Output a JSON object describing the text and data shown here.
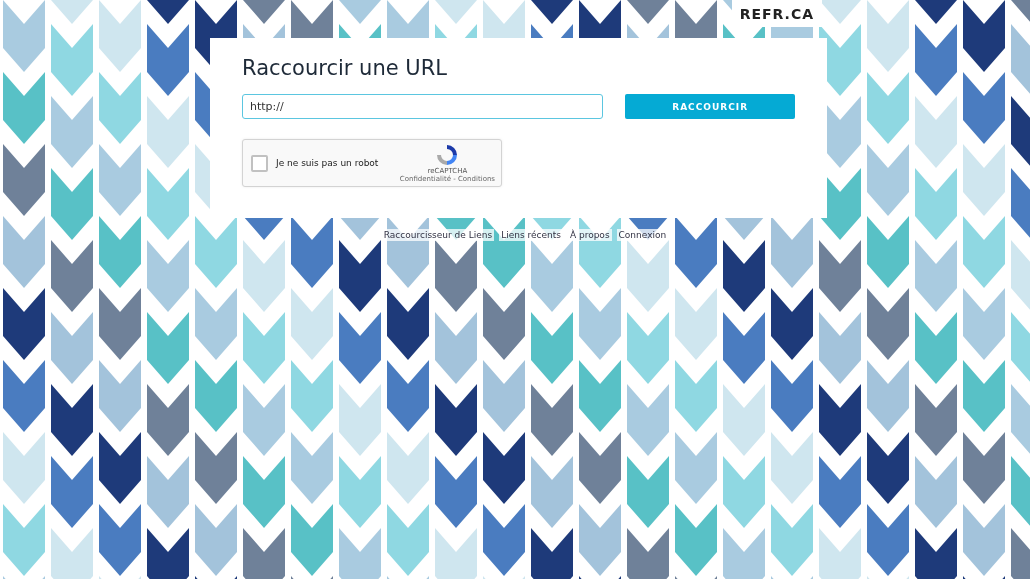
{
  "logo": "REFR.CA",
  "form": {
    "title": "Raccourcir une URL",
    "url_field": {
      "value": "http://"
    },
    "submit_button": "RACCOURCIR"
  },
  "captcha": {
    "label": "Je ne suis pas un robot",
    "checked": false,
    "brand": "reCAPTCHA",
    "links": "Confidentialité - Conditions"
  },
  "footer_links": [
    "Raccourcisseur de Liens",
    "Liens récents",
    "À propos",
    "Connexion"
  ]
}
